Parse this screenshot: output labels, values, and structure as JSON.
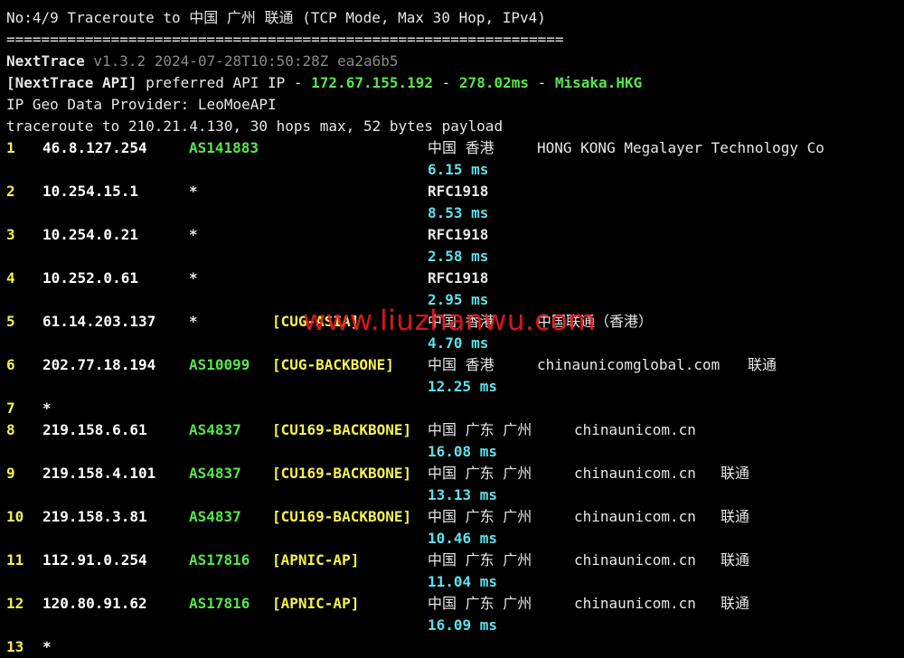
{
  "header": {
    "title": "No:4/9 Traceroute to 中国 广州 联通 (TCP Mode, Max 30 Hop, IPv4)",
    "separator": "================================================================",
    "nexttrace_label": "NextTrace",
    "nexttrace_version": "v1.3.2 2024-07-28T10:50:28Z ea2a6b5",
    "api_label": "[NextTrace API]",
    "api_text": " preferred API IP - ",
    "api_ip": "172.67.155.192",
    "api_dash1": " - ",
    "api_latency": "278.02ms",
    "api_dash2": " - ",
    "api_region": "Misaka.HKG",
    "geo_provider": "IP Geo Data Provider: LeoMoeAPI",
    "trace_line": "traceroute to 210.21.4.130, 30 hops max, 52 bytes payload"
  },
  "hops": [
    {
      "num": "1",
      "ip": "46.8.127.254",
      "asn": "AS141883",
      "tag": "",
      "geo": "中国 香港",
      "detail": "HONG KONG Megalayer Technology Co",
      "extra": "",
      "latency": "6.15 ms"
    },
    {
      "num": "2",
      "ip": "10.254.15.1",
      "asn": "*",
      "tag": "",
      "geo": "RFC1918",
      "detail": "",
      "extra": "",
      "latency": "8.53 ms"
    },
    {
      "num": "3",
      "ip": "10.254.0.21",
      "asn": "*",
      "tag": "",
      "geo": "RFC1918",
      "detail": "",
      "extra": "",
      "latency": "2.58 ms"
    },
    {
      "num": "4",
      "ip": "10.252.0.61",
      "asn": "*",
      "tag": "",
      "geo": "RFC1918",
      "detail": "",
      "extra": "",
      "latency": "2.95 ms"
    },
    {
      "num": "5",
      "ip": "61.14.203.137",
      "asn": "*",
      "tag": "[CUG-ASIA]",
      "geo": "中国 香港",
      "detail": "中国联通（香港）",
      "extra": "",
      "latency": "4.70 ms"
    },
    {
      "num": "6",
      "ip": "202.77.18.194",
      "asn": "AS10099",
      "tag": "[CUG-BACKBONE]",
      "geo": "中国 香港",
      "detail": "chinaunicomglobal.com",
      "extra": "联通",
      "latency": "12.25 ms"
    },
    {
      "num": "7",
      "ip": "*",
      "asn": "",
      "tag": "",
      "geo": "",
      "detail": "",
      "extra": "",
      "latency": ""
    },
    {
      "num": "8",
      "ip": "219.158.6.61",
      "asn": "AS4837",
      "tag": "[CU169-BACKBONE]",
      "geo": "中国 广东 广州",
      "detail": "chinaunicom.cn",
      "extra": "",
      "latency": "16.08 ms"
    },
    {
      "num": "9",
      "ip": "219.158.4.101",
      "asn": "AS4837",
      "tag": "[CU169-BACKBONE]",
      "geo": "中国 广东 广州",
      "detail": "chinaunicom.cn",
      "extra": "联通",
      "latency": "13.13 ms"
    },
    {
      "num": "10",
      "ip": "219.158.3.81",
      "asn": "AS4837",
      "tag": "[CU169-BACKBONE]",
      "geo": "中国 广东 广州",
      "detail": "chinaunicom.cn",
      "extra": "联通",
      "latency": "10.46 ms"
    },
    {
      "num": "11",
      "ip": "112.91.0.254",
      "asn": "AS17816",
      "tag": "[APNIC-AP]",
      "geo": "中国 广东 广州",
      "detail": "chinaunicom.cn",
      "extra": "联通",
      "latency": "11.04 ms"
    },
    {
      "num": "12",
      "ip": "120.80.91.62",
      "asn": "AS17816",
      "tag": "[APNIC-AP]",
      "geo": "中国 广东 广州",
      "detail": "chinaunicom.cn",
      "extra": "联通",
      "latency": "16.09 ms"
    },
    {
      "num": "13",
      "ip": "*",
      "asn": "",
      "tag": "",
      "geo": "",
      "detail": "",
      "extra": "",
      "latency": ""
    }
  ],
  "watermark": "www.liuzhanwu.com",
  "colors": {
    "background": "#000000",
    "text": "#e6e6e6",
    "hop_number": "#f5f24e",
    "asn": "#57e64b",
    "tag": "#f5f24e",
    "latency": "#5ee1ee",
    "watermark": "#e8191f"
  }
}
